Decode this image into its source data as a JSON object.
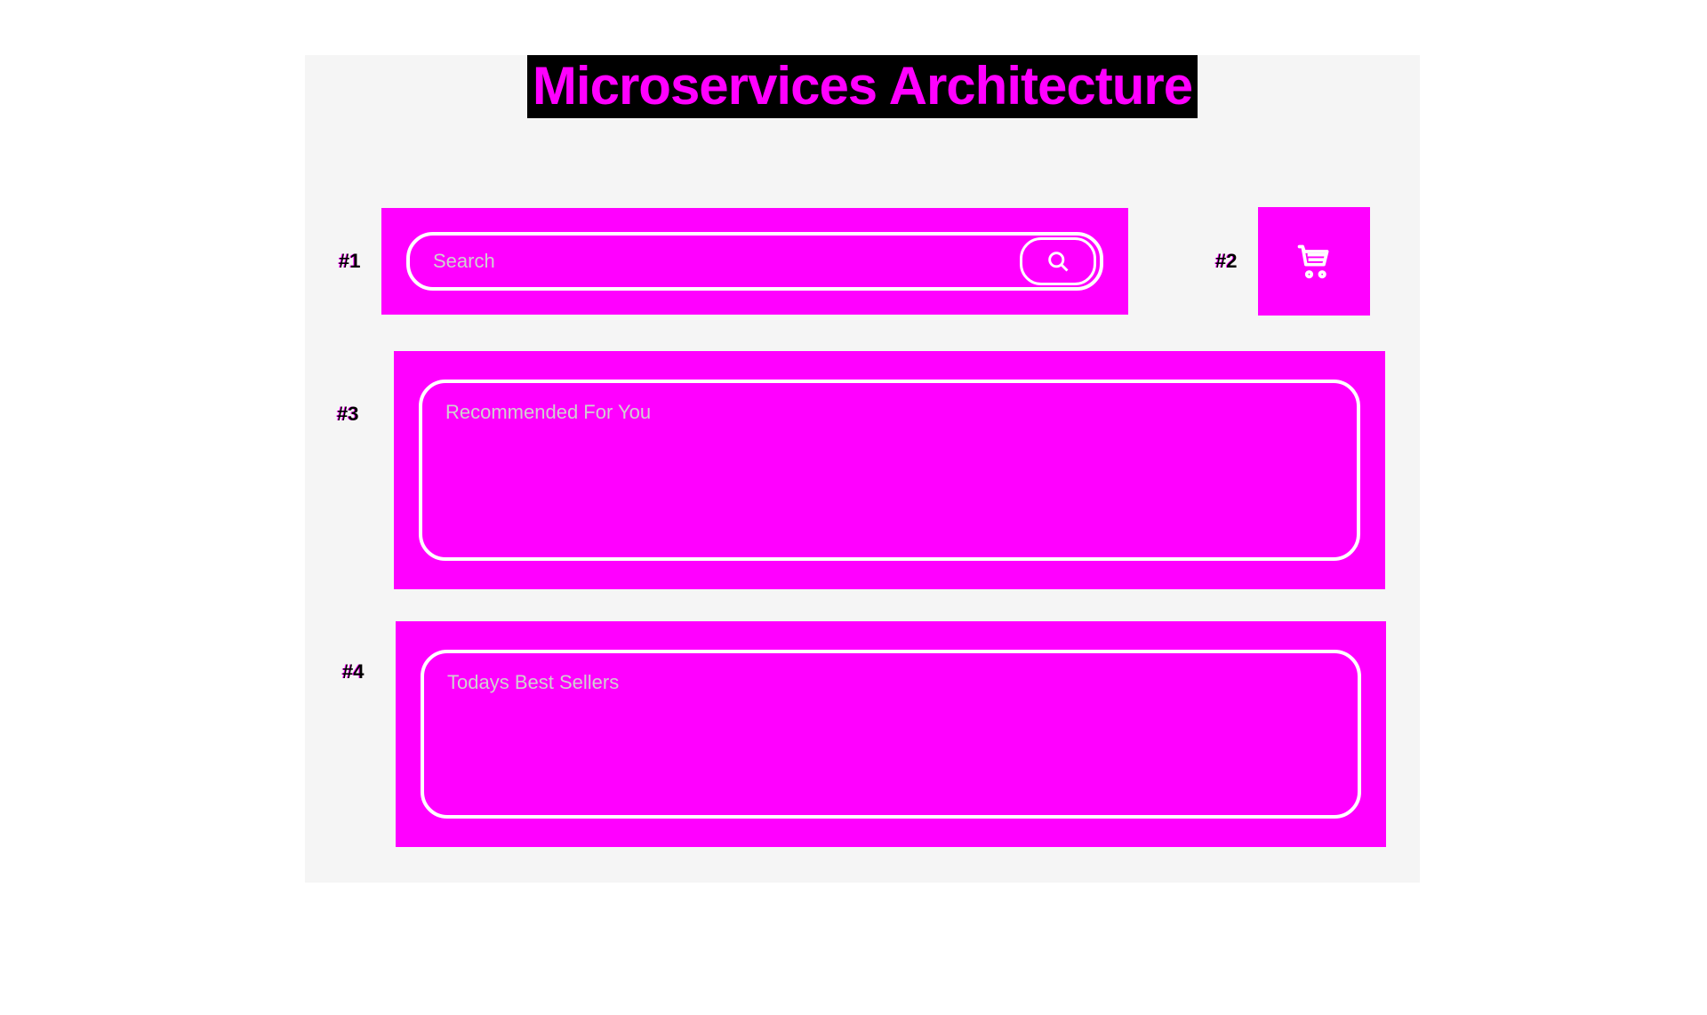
{
  "title": "Microservices Architecture",
  "sections": {
    "s1": {
      "label": "#1",
      "search_placeholder": "Search"
    },
    "s2": {
      "label": "#2"
    },
    "s3": {
      "label": "#3",
      "heading": "Recommended For You"
    },
    "s4": {
      "label": "#4",
      "heading": "Todays Best Sellers"
    }
  },
  "colors": {
    "accent": "#ff00ff",
    "bg": "#f5f5f5",
    "text_muted": "#d0d0d0"
  }
}
